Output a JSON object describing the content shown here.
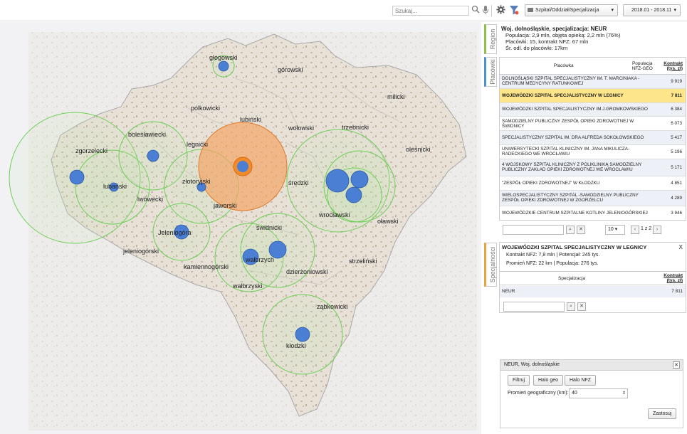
{
  "toolbar": {
    "search_placeholder": "Szukaj...",
    "filter_select": "Szpital/Oddział/Specjalizacja",
    "date_range": "2018.01 - 2018.11"
  },
  "map": {
    "counties": [
      {
        "label": "głogowski"
      },
      {
        "label": "górowski"
      },
      {
        "label": "milicki"
      },
      {
        "label": "polkowicki"
      },
      {
        "label": "lubiński"
      },
      {
        "label": "wołowski"
      },
      {
        "label": "trzebnicki"
      },
      {
        "label": "oleśnicki"
      },
      {
        "label": "bolesławiecki"
      },
      {
        "label": "legnicki"
      },
      {
        "label": "zgorzelecki"
      },
      {
        "label": "lubański"
      },
      {
        "label": "złotoryjski"
      },
      {
        "label": "średzki"
      },
      {
        "label": "lwówecki"
      },
      {
        "label": "jaworski"
      },
      {
        "label": "wrocławski"
      },
      {
        "label": "oławski"
      },
      {
        "label": "świdnicki"
      },
      {
        "label": "Jeleniogóra"
      },
      {
        "label": "jeleniogórski"
      },
      {
        "label": "wałbrzych"
      },
      {
        "label": "kamiennogórski"
      },
      {
        "label": "dzierżoniowski"
      },
      {
        "label": "strzeliński"
      },
      {
        "label": "wałbrzyski"
      },
      {
        "label": "ząbkowicki"
      },
      {
        "label": "kłodzki"
      }
    ]
  },
  "tabs": {
    "region": "Region",
    "placowki": "Placówki",
    "specjalnosci": "Specjalności"
  },
  "region": {
    "title": "Woj. dolnośląskie, specjalizacja: NEUR",
    "population": "Populacja: 2,9 mln, objęta opieką: 2,2 mln (76%)",
    "facilities": "Placówki: 15, kontrakt NFZ: 67 mln",
    "distance": "Śr. odl. do placówki: 17km"
  },
  "facilities_table": {
    "col_name": "Placówka",
    "col_pop": "Populacja NFZ-GEO",
    "col_contract": "Kontrakt (tys. zł)",
    "rows": [
      {
        "name": "DOLNOŚLĄSKI SZPITAL SPECJALISTYCZNY IM. T. MARCINIAKA - CENTRUM MEDYCYNY RATUNKOWEJ",
        "value": "9 919"
      },
      {
        "name": "WOJEWÓDZKI SZPITAL SPECJALISTYCZNY W LEGNICY",
        "value": "7 811"
      },
      {
        "name": "WOJEWÓDZKI SZPITAL SPECJALISTYCZNY IM.J.GROMKOWSKIEGO",
        "value": "6 384"
      },
      {
        "name": "SAMODZIELNY PUBLICZNY ZESPÓŁ OPIEKI ZDROWOTNEJ W ŚWIDNICY",
        "value": "6 073"
      },
      {
        "name": "SPECJALISTYCZNY SZPITAL IM. DRA ALFREDA SOKOŁOWSKIEGO",
        "value": "5 417"
      },
      {
        "name": "UNIWERSYTECKI SZPITAL KLINICZNY IM. JANA MIKULICZA-RADECKIEGO WE WROCŁAWIU",
        "value": "5 196"
      },
      {
        "name": "4 WOJSKOWY SZPITAL KLINICZNY Z POLIKLINIKĄ SAMODZIELNY PUBLICZNY ZAKŁAD OPIEKI ZDROWOTNEJ WE WROCŁAWIU",
        "value": "5 171"
      },
      {
        "name": "\"ZESPÓŁ OPIEKI ZDROWOTNEJ\" W KŁODZKU",
        "value": "4 851"
      },
      {
        "name": "WIELOSPECJALISTYCZNY SZPITAL -SAMODZIELNY PUBLICZNY ZESPÓŁ OPIEKI ZDROWOTNEJ W ZGORZELCU",
        "value": "4 289"
      },
      {
        "name": "WOJEWÓDZKIE CENTRUM SZPITALNE KOTLINY JELENIOGÓRSKIEJ",
        "value": "3 946"
      }
    ],
    "page_size": "10",
    "page_info": "1 z 2"
  },
  "spec_panel": {
    "title": "WOJEWÓDZKI SZPITAL SPECJALISTYCZNY W LEGNICY",
    "contract_line": "Kontrakt NFZ: 7,8 mln | Potencjał: 245 tys.",
    "radius_line": "Promień NFZ: 22 km | Populacja: 276 tys.",
    "col_spec": "Specjalizacja",
    "col_contract": "Kontrakt (tys. zł)",
    "rows": [
      {
        "name": "NEUR",
        "value": "7 811"
      }
    ],
    "close": "X"
  },
  "dialog": {
    "title": "NEUR, Woj. dolnośląskie",
    "btn_filter": "Filtruj",
    "btn_halo_geo": "Halo geo",
    "btn_halo_nfz": "Halo NFZ",
    "radius_label": "Promień geograficzny (km):",
    "radius_value": "40",
    "apply": "Zastosuj",
    "close": "✕"
  },
  "colors": {
    "accent_orange": "#f2a25c",
    "marker_blue": "#4a7fd4",
    "halo_green": "#6ccf55",
    "highlight": "#fde58a"
  }
}
